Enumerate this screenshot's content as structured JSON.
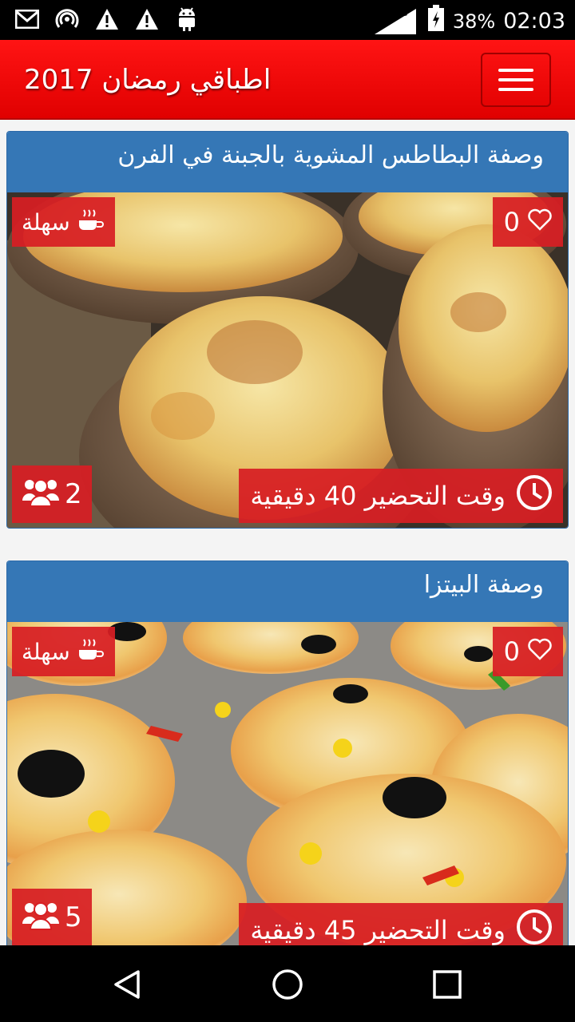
{
  "status_bar": {
    "icons": [
      "gmail-icon",
      "hotspot-icon",
      "warning-icon",
      "warning-icon",
      "android-icon"
    ],
    "network": "4G",
    "battery": "38%",
    "time": "02:03"
  },
  "app_bar": {
    "title": "اطباقي رمضان 2017",
    "menu_icon": "hamburger-menu-icon"
  },
  "recipes": [
    {
      "title": "وصفة البطاطس المشوية بالجبنة في الفرن",
      "difficulty": "سهلة",
      "likes": "0",
      "servings": "2",
      "prep_time": "وقت التحضير 40 دقيقية"
    },
    {
      "title": "وصفة البيتزا",
      "difficulty": "سهلة",
      "likes": "0",
      "servings": "5",
      "prep_time": "وقت التحضير 45 دقيقية"
    }
  ],
  "nav_bar": {
    "buttons": [
      "back-icon",
      "home-icon",
      "recents-icon"
    ]
  },
  "colors": {
    "app_bar": "#e80000",
    "card_header": "#3577b6",
    "badge": "#d71e23"
  }
}
